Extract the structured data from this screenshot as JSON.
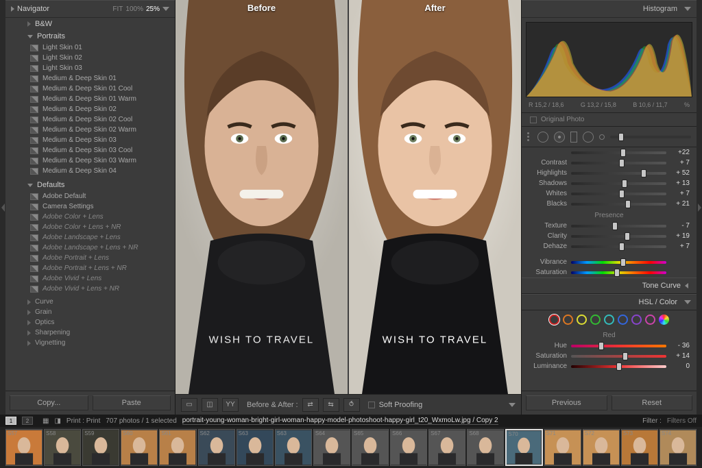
{
  "navigator": {
    "title": "Navigator",
    "zooms": [
      "FIT",
      "100%",
      "25%"
    ]
  },
  "presets": {
    "bw": "B&W",
    "portraits": {
      "label": "Portraits",
      "items": [
        "Light Skin 01",
        "Light Skin 02",
        "Light Skin 03",
        "Medium & Deep Skin 01",
        "Medium & Deep Skin 01 Cool",
        "Medium & Deep Skin 01 Warm",
        "Medium & Deep Skin 02",
        "Medium & Deep Skin 02 Cool",
        "Medium & Deep Skin 02 Warm",
        "Medium & Deep Skin 03",
        "Medium & Deep Skin 03 Cool",
        "Medium & Deep Skin 03 Warm",
        "Medium & Deep Skin 04"
      ]
    },
    "defaults": {
      "label": "Defaults",
      "items": [
        "Adobe Default",
        "Camera Settings",
        "Adobe Color + Lens",
        "Adobe Color + Lens + NR",
        "Adobe Landscape + Lens",
        "Adobe Landscape + Lens + NR",
        "Adobe Portrait + Lens",
        "Adobe Portrait + Lens + NR",
        "Adobe Vivid + Lens",
        "Adobe Vivid + Lens + NR"
      ]
    },
    "others": [
      "Curve",
      "Grain",
      "Optics",
      "Sharpening",
      "Vignetting"
    ]
  },
  "leftButtons": {
    "copy": "Copy...",
    "paste": "Paste"
  },
  "compare": {
    "before": "Before",
    "after": "After"
  },
  "toolbar": {
    "beforeAfter": "Before & After :",
    "softProofing": "Soft Proofing"
  },
  "histogram": {
    "title": "Histogram",
    "readout": {
      "r": "R  15,2 / 18,6",
      "g": "G  13,2 / 15,8",
      "b": "B  10,6 / 11,7",
      "pct": "%"
    },
    "original": "Original Photo"
  },
  "basic": {
    "rows": [
      {
        "lab": "",
        "val": "+22",
        "pos": 55,
        "cls": ""
      },
      {
        "lab": "Contrast",
        "val": "+ 7",
        "pos": 53,
        "cls": ""
      },
      {
        "lab": "Highlights",
        "val": "+ 52",
        "pos": 76,
        "cls": ""
      },
      {
        "lab": "Shadows",
        "val": "+ 13",
        "pos": 56,
        "cls": ""
      },
      {
        "lab": "Whites",
        "val": "+ 7",
        "pos": 53,
        "cls": ""
      },
      {
        "lab": "Blacks",
        "val": "+ 21",
        "pos": 60,
        "cls": ""
      }
    ],
    "presence": "Presence",
    "prows": [
      {
        "lab": "Texture",
        "val": "- 7",
        "pos": 46,
        "cls": ""
      },
      {
        "lab": "Clarity",
        "val": "+ 19",
        "pos": 59,
        "cls": ""
      },
      {
        "lab": "Dehaze",
        "val": "+ 7",
        "pos": 53,
        "cls": ""
      }
    ],
    "vrows": [
      {
        "lab": "Vibrance",
        "val": "",
        "pos": 55,
        "cls": "rainbow"
      },
      {
        "lab": "Saturation",
        "val": "",
        "pos": 48,
        "cls": "rainbow"
      }
    ]
  },
  "panels": {
    "toneCurve": "Tone Curve",
    "hsl": "HSL / Color"
  },
  "hsl": {
    "colors": [
      "#cc2222",
      "#dd7722",
      "#dddd33",
      "#33bb33",
      "#33bbbb",
      "#3366dd",
      "#8844cc",
      "#cc44aa"
    ],
    "label": "Red",
    "rows": [
      {
        "lab": "Hue",
        "val": "- 36",
        "pos": 32,
        "cls": "hue-red"
      },
      {
        "lab": "Saturation",
        "val": "+ 14",
        "pos": 57,
        "cls": "sat-red"
      },
      {
        "lab": "Luminance",
        "val": "0",
        "pos": 50,
        "cls": "lum-red"
      }
    ]
  },
  "rightButtons": {
    "prev": "Previous",
    "reset": "Reset"
  },
  "status": {
    "pages": [
      "1",
      "2"
    ],
    "print": "Print : Print",
    "count": "707 photos / 1 selected",
    "path": "portrait-young-woman-bright-girl-woman-happy-model-photoshoot-happy-girl_t20_WxmoLw.jpg / Copy 2",
    "filter": "Filter :",
    "filtersOff": "Filters Off"
  },
  "thumbs": [
    "S57",
    "S58",
    "S59",
    "S60",
    "S61",
    "S62",
    "S63",
    "S63",
    "S64",
    "S65",
    "S66",
    "S67",
    "S68",
    "S70",
    "S71",
    "S72",
    "S73",
    "S74"
  ]
}
